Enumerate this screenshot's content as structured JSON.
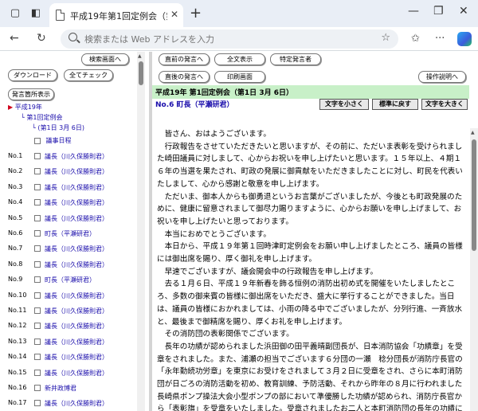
{
  "browser": {
    "tab_title": "平成19年第1回定例会（第1日 3月",
    "address_placeholder": "検索または Web アドレスを入力"
  },
  "left": {
    "buttons": {
      "search_screen": "検索画面へ",
      "download": "ダウンロード",
      "check_all": "全てチェック",
      "list_display": "発言箇所表示"
    },
    "tree": {
      "year": "平成19年",
      "session": "第1回定例会",
      "day": "(第1日 3月 6日)",
      "agenda": "議事日程"
    },
    "speakers": [
      {
        "no": "No.1",
        "name": "議長（川久保勝則君）"
      },
      {
        "no": "No.2",
        "name": "議長（川久保勝則君）"
      },
      {
        "no": "No.3",
        "name": "議長（川久保勝則君）"
      },
      {
        "no": "No.4",
        "name": "議長（川久保勝則君）"
      },
      {
        "no": "No.5",
        "name": "議長（川久保勝則君）"
      },
      {
        "no": "No.6",
        "name": "町長（平瀬研君）"
      },
      {
        "no": "No.7",
        "name": "議長（川久保勝則君）"
      },
      {
        "no": "No.8",
        "name": "議長（川久保勝則君）"
      },
      {
        "no": "No.9",
        "name": "町長（平瀬研君）"
      },
      {
        "no": "No.10",
        "name": "議長（川久保勝則君）"
      },
      {
        "no": "No.11",
        "name": "議長（川久保勝則君）"
      },
      {
        "no": "No.12",
        "name": "議長（川久保勝則君）"
      },
      {
        "no": "No.13",
        "name": "議長（川久保勝則君）"
      },
      {
        "no": "No.14",
        "name": "議長（川久保勝則君）"
      },
      {
        "no": "No.15",
        "name": "議長（川久保勝則君）"
      },
      {
        "no": "No.16",
        "name": "新井政博君"
      },
      {
        "no": "No.17",
        "name": "議長（川久保勝則君）"
      }
    ]
  },
  "right": {
    "buttons": {
      "prev_speech": "直前の発言へ",
      "show_all": "全文表示",
      "specific_speaker": "特定発言者",
      "next_speech": "直後の発言へ",
      "print_screen": "印刷画面",
      "instructions": "操作説明へ"
    },
    "session_title": "平成19年 第1回定例会（第1日 3月 6日）",
    "speaker_heading": "No.6 町長（平瀬研君）",
    "font_buttons": {
      "smaller": "文字を小さく",
      "reset": "標準に戻す",
      "larger": "文字を大きく"
    },
    "paragraphs": [
      "皆さん、おはようございます。",
      "行政報告をさせていただきたいと思いますが、その前に、ただいま表彰を受けられました崎田議員に対しまして、心からお祝いを申し上げたいと思います。１５年以上、４期１６年の当選を果たされ、町政の発展に御貢献をいただきましたことに対し、町民を代表いたしまして、心から感謝と敬意を申し上げます。",
      "ただいま、御本人からも御勇退というお言葉がございましたが、今後とも町政発展のために、健康に留意されまして御尽力賜りますように、心からお願いを申し上げまして、お祝いを申し上げたいと思っております。",
      "本当におめでとうございます。",
      "本日から、平成１９年第１回時津町定例会をお願い申し上げましたところ、議員の皆様には御出席を賜り、厚く御礼を申し上げます。",
      "早速でございますが、議会開会中の行政報告を申し上げます。",
      "去る１月６日、平成１９年新春を飾る恒例の消防出初め式を開催をいたしましたところ、多数の御来賓の皆様に御出席をいただき、盛大に挙行することができました。当日は、議員の皆様におかれましては、小雨の降る中でございましたが、分列行進、一斉放水と、最後まで御精席を賜り、厚くお礼を申し上げます。",
      "その消防団の表彰関係でございます。",
      "長年の功績が認められました浜田御の田平義晴副団長が、日本消防協会「功績章」を受章をされました。また、浦瀬の担当でございます６分団の一瀬　稔分団長が消防庁長官の「永年勤続功労章」を東京にお受けをされまして３月２日に受章をされ、さらに本町消防団が日ごろの消防活動を初め、教育訓練、予防活動、それから昨年の８月に行われました長崎県ポンプ操法大会小型ポンプの部において準優勝した功績が認められ、消防庁長官から「表彰旗」を受章をいたしました。受章されましたお二人と本町消防団の長年の功績に感謝をいたしますとともに、お祝いを申し上げます。"
    ]
  }
}
